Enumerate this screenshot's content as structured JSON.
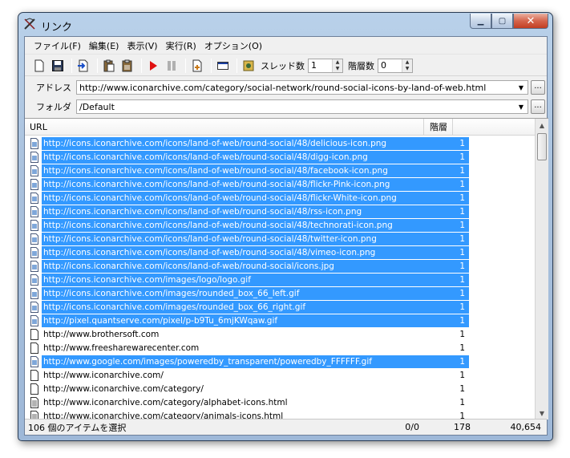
{
  "window": {
    "title": "リンク"
  },
  "menu": [
    {
      "label": "ファイル(F)"
    },
    {
      "label": "編集(E)"
    },
    {
      "label": "表示(V)"
    },
    {
      "label": "実行(R)"
    },
    {
      "label": "オプション(O)"
    }
  ],
  "toolbar": {
    "thread_label": "スレッド数",
    "thread_value": "1",
    "depth_label": "階層数",
    "depth_value": "0"
  },
  "address": {
    "label": "アドレス",
    "value": "http://www.iconarchive.com/category/social-network/round-social-icons-by-land-of-web.html"
  },
  "folder": {
    "label": "フォルダ",
    "value": "/Default"
  },
  "list": {
    "headers": {
      "url": "URL",
      "depth": "階層"
    },
    "rows": [
      {
        "url": "http://icons.iconarchive.com/icons/land-of-web/round-social/48/delicious-icon.png",
        "depth": "1",
        "selected": true,
        "icon": "image-file-icon"
      },
      {
        "url": "http://icons.iconarchive.com/icons/land-of-web/round-social/48/digg-icon.png",
        "depth": "1",
        "selected": true,
        "icon": "image-file-icon"
      },
      {
        "url": "http://icons.iconarchive.com/icons/land-of-web/round-social/48/facebook-icon.png",
        "depth": "1",
        "selected": true,
        "icon": "image-file-icon"
      },
      {
        "url": "http://icons.iconarchive.com/icons/land-of-web/round-social/48/flickr-Pink-icon.png",
        "depth": "1",
        "selected": true,
        "icon": "image-file-icon"
      },
      {
        "url": "http://icons.iconarchive.com/icons/land-of-web/round-social/48/flickr-White-icon.png",
        "depth": "1",
        "selected": true,
        "icon": "image-file-icon"
      },
      {
        "url": "http://icons.iconarchive.com/icons/land-of-web/round-social/48/rss-icon.png",
        "depth": "1",
        "selected": true,
        "icon": "image-file-icon"
      },
      {
        "url": "http://icons.iconarchive.com/icons/land-of-web/round-social/48/technorati-icon.png",
        "depth": "1",
        "selected": true,
        "icon": "image-file-icon"
      },
      {
        "url": "http://icons.iconarchive.com/icons/land-of-web/round-social/48/twitter-icon.png",
        "depth": "1",
        "selected": true,
        "icon": "image-file-icon"
      },
      {
        "url": "http://icons.iconarchive.com/icons/land-of-web/round-social/48/vimeo-icon.png",
        "depth": "1",
        "selected": true,
        "icon": "image-file-icon"
      },
      {
        "url": "http://icons.iconarchive.com/icons/land-of-web/round-social/icons.jpg",
        "depth": "1",
        "selected": true,
        "icon": "image-file-icon"
      },
      {
        "url": "http://icons.iconarchive.com/images/logo/logo.gif",
        "depth": "1",
        "selected": true,
        "icon": "image-file-icon"
      },
      {
        "url": "http://icons.iconarchive.com/images/rounded_box_66_left.gif",
        "depth": "1",
        "selected": true,
        "icon": "image-file-icon"
      },
      {
        "url": "http://icons.iconarchive.com/images/rounded_box_66_right.gif",
        "depth": "1",
        "selected": true,
        "icon": "image-file-icon"
      },
      {
        "url": "http://pixel.quantserve.com/pixel/p-b9Tu_6mjKWqaw.gif",
        "depth": "1",
        "selected": true,
        "icon": "image-file-icon"
      },
      {
        "url": "http://www.brothersoft.com",
        "depth": "1",
        "selected": false,
        "icon": "blank-file-icon"
      },
      {
        "url": "http://www.freesharewarecenter.com",
        "depth": "1",
        "selected": false,
        "icon": "blank-file-icon"
      },
      {
        "url": "http://www.google.com/images/poweredby_transparent/poweredby_FFFFFF.gif",
        "depth": "1",
        "selected": true,
        "icon": "image-file-icon"
      },
      {
        "url": "http://www.iconarchive.com/",
        "depth": "1",
        "selected": false,
        "icon": "blank-file-icon"
      },
      {
        "url": "http://www.iconarchive.com/category/",
        "depth": "1",
        "selected": false,
        "icon": "blank-file-icon"
      },
      {
        "url": "http://www.iconarchive.com/category/alphabet-icons.html",
        "depth": "1",
        "selected": false,
        "icon": "text-file-icon"
      },
      {
        "url": "http://www.iconarchive.com/category/animals-icons.html",
        "depth": "1",
        "selected": false,
        "icon": "text-file-icon"
      }
    ]
  },
  "status": {
    "message": "106 個のアイテムを選択",
    "progress": "0/0",
    "count": "178",
    "size": "40,654"
  }
}
